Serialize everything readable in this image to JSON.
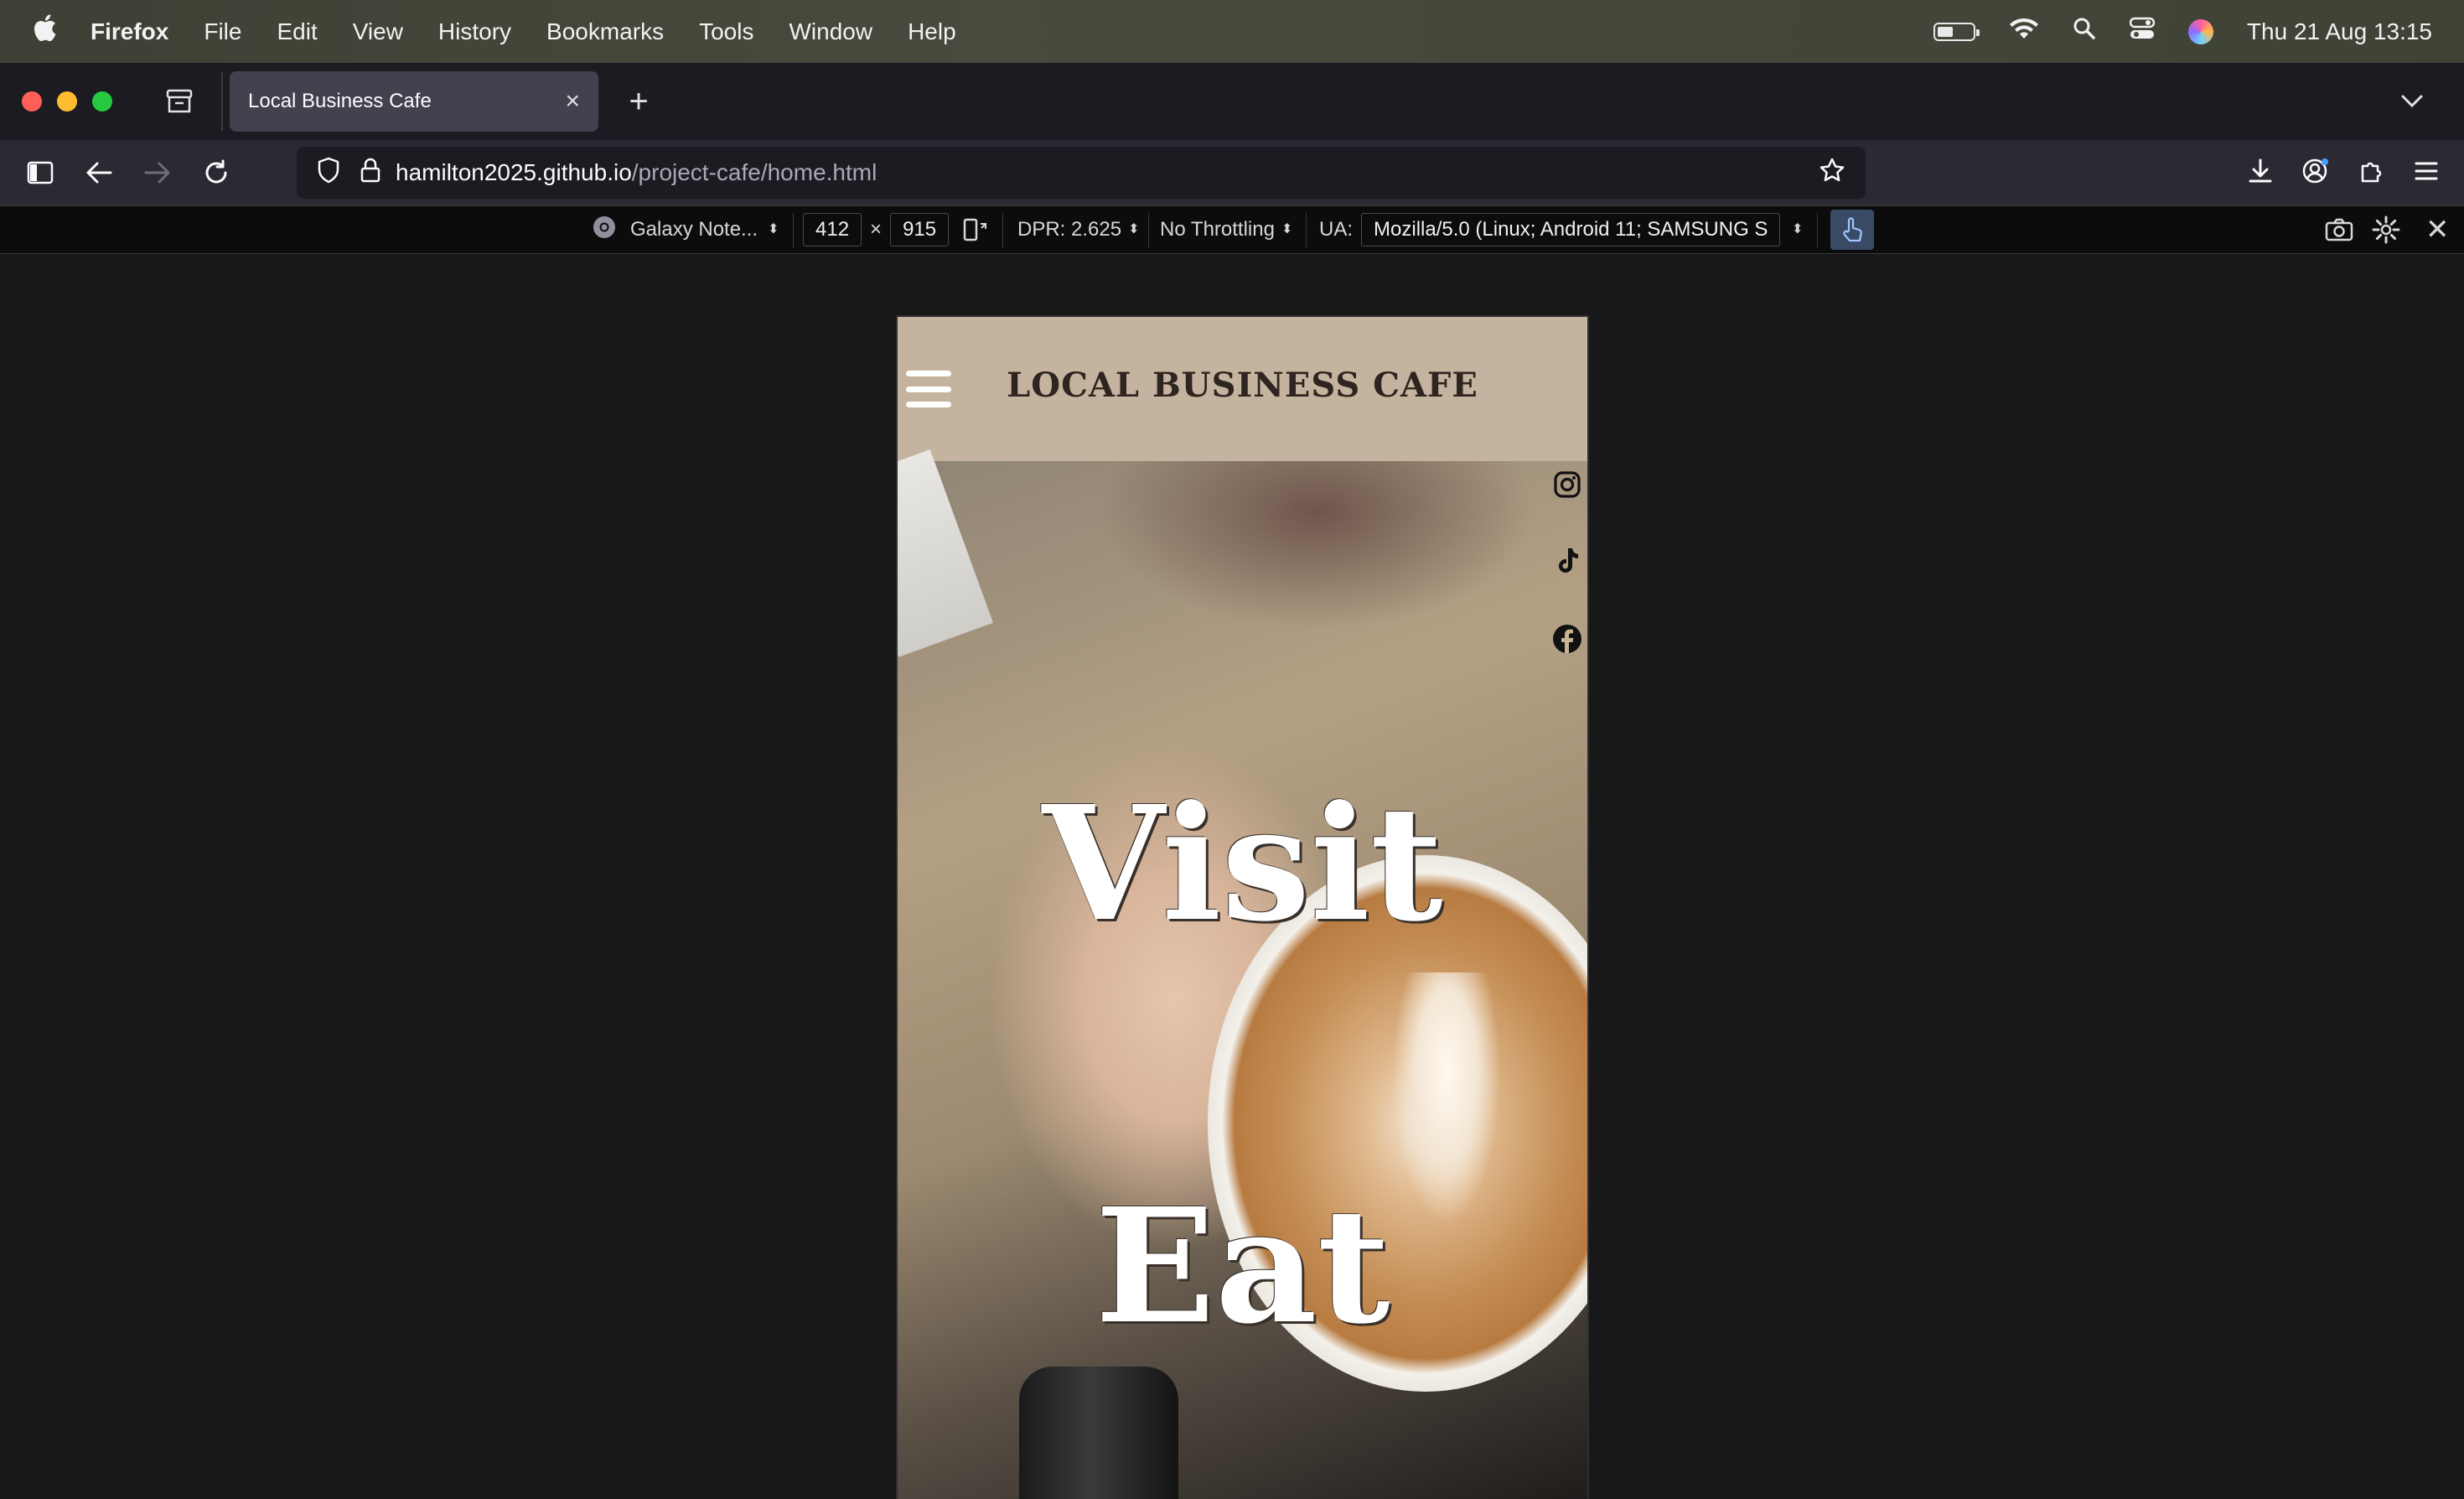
{
  "menubar": {
    "app_name": "Firefox",
    "items": [
      "File",
      "Edit",
      "View",
      "History",
      "Bookmarks",
      "Tools",
      "Window",
      "Help"
    ],
    "datetime": "Thu 21 Aug  13:15"
  },
  "tabs": [
    {
      "title": "Local Business Cafe",
      "active": true
    }
  ],
  "address_bar": {
    "host": "hamilton2025.github.io",
    "path": "/project-cafe/home.html"
  },
  "rdm_toolbar": {
    "device": "Galaxy Note...",
    "width": "412",
    "times": "×",
    "height": "915",
    "dpr": "DPR: 2.625",
    "throttling": "No Throttling",
    "ua_label": "UA:",
    "ua_value": "Mozilla/5.0 (Linux; Android 11; SAMSUNG S"
  },
  "site": {
    "title": "LOCAL BUSINESS CAFE",
    "hero_words": [
      "Visit",
      "Eat"
    ],
    "social_icons": [
      "instagram-icon",
      "tiktok-icon",
      "facebook-icon"
    ]
  },
  "colors": {
    "header_bg": "#c4b49f",
    "title_text": "#2f2520",
    "browser_bg": "#1c1b22",
    "toolbar_bg": "#2b2a33",
    "active_tab": "#42414d"
  }
}
